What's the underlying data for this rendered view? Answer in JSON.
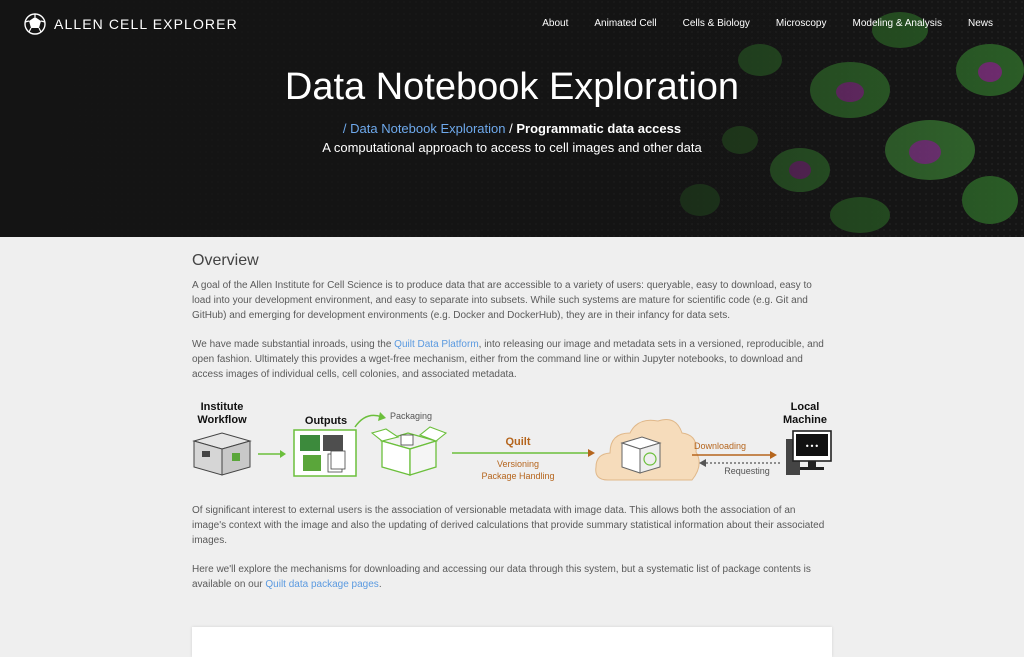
{
  "brand": {
    "name": "ALLEN CELL EXPLORER"
  },
  "nav": [
    "About",
    "Animated Cell",
    "Cells & Biology",
    "Microscopy",
    "Modeling & Analysis",
    "News"
  ],
  "hero": {
    "title": "Data Notebook Exploration",
    "breadcrumb_sep1": "/ ",
    "breadcrumb_link": "Data Notebook Exploration",
    "breadcrumb_sep2": " / ",
    "breadcrumb_current": "Programmatic data access",
    "subtitle": "A computational approach to access to cell images and other data"
  },
  "overview": {
    "heading": "Overview",
    "p1": "A goal of the Allen Institute for Cell Science is to produce data that are accessible to a variety of users: queryable, easy to download, easy to load into your development environment, and easy to separate into subsets. While such systems are mature for scientific code (e.g. Git and GitHub) and emerging for development environments (e.g. Docker and DockerHub), they are in their infancy for data sets.",
    "p2_before": "We have made substantial inroads, using the ",
    "p2_link": "Quilt Data Platform",
    "p2_after": ", into releasing our image and metadata sets in a versioned, reproducible, and open fashion. Ultimately this provides a wget-free mechanism, either from the command line or within Jupyter notebooks, to download and access images of individual cells, cell colonies, and associated metadata.",
    "p3": "Of significant interest to external users is the association of versionable metadata with image data. This allows both the association of an image's context with the image and also the updating of derived calculations that provide summary statistical information about their associated images.",
    "p4_before": "Here we'll explore the mechanisms for downloading and accessing our data through this system, but a systematic list of package contents is available on our ",
    "p4_link": "Quilt data package pages",
    "p4_after": "."
  },
  "diagram": {
    "institute_line1": "Institute",
    "institute_line2": "Workflow",
    "outputs": "Outputs",
    "packaging": "Packaging",
    "quilt": "Quilt",
    "versioning_line1": "Versioning",
    "versioning_line2": "Package Handling",
    "downloading": "Downloading",
    "requesting": "Requesting",
    "local_line1": "Local",
    "local_line2": "Machine",
    "screen_dots": "•••"
  },
  "colors": {
    "link": "#5b9ae0",
    "quilt_orange": "#b5651d",
    "green": "#6bbf3b",
    "cloud": "#f6dcbb"
  }
}
